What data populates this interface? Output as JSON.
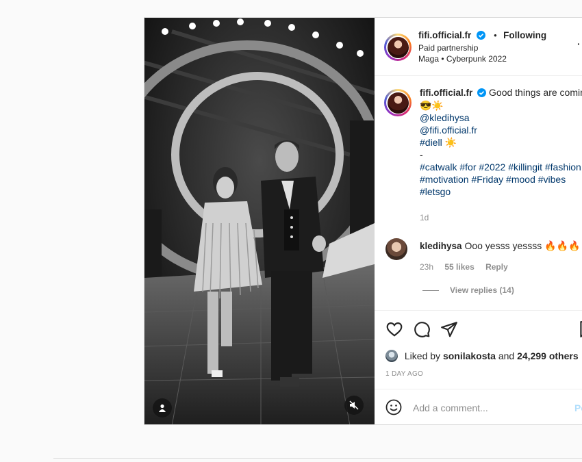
{
  "post": {
    "author": {
      "username": "fifi.official.fr",
      "verified": true,
      "follow_status": "Following",
      "follow_separator": "•",
      "partnership": "Paid partnership",
      "audio": "Maga • Cyberpunk 2022",
      "more": "·"
    },
    "caption": {
      "username": "fifi.official.fr",
      "lines": [
        "Good things are comin",
        "😎☀️",
        "@kledihysa",
        "@fifi.official.fr",
        "#diell ☀️",
        "-",
        "#catwalk #for #2022 #killingit #fashion",
        "#motivation #Friday #mood #vibes",
        "#letsgo"
      ],
      "time": "1d"
    },
    "comment": {
      "username": "kledihysa",
      "text": "Ooo yesss yessss 🔥🔥🔥",
      "time": "23h",
      "likes": "55 likes",
      "reply": "Reply",
      "view_replies": "View replies (14)"
    },
    "likes": {
      "prefix": "Liked by",
      "user": "sonilakosta",
      "and": "and",
      "others": "24,299 others"
    },
    "date": "1 DAY AGO",
    "add_comment": {
      "placeholder": "Add a comment...",
      "post": "Po"
    }
  },
  "colors": {
    "link": "#00376b",
    "verified": "#0095f6",
    "muted": "#8e8e8e",
    "post_button": "#b2dffc"
  }
}
